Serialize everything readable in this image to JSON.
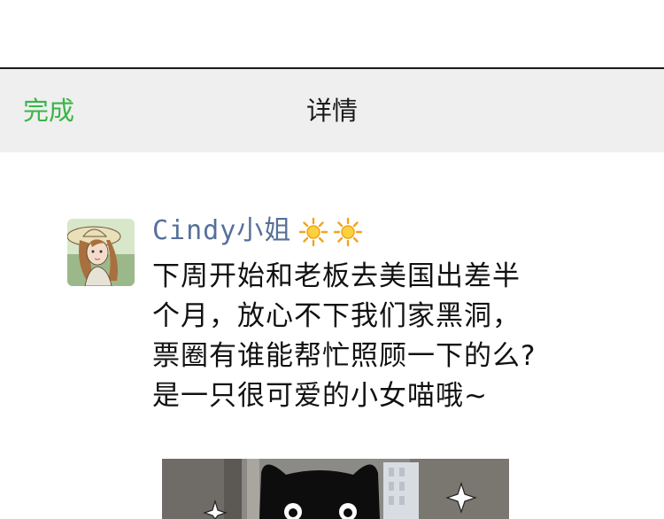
{
  "navbar": {
    "done_label": "完成",
    "title": "详情"
  },
  "post": {
    "username": "Cindy小姐",
    "emojis": [
      "sun-icon",
      "sun-icon"
    ],
    "lines": [
      "下周开始和老板去美国出差半",
      "个月，放心不下我们家黑洞，",
      "票圈有谁能帮忙照顾一下的么?",
      "是一只很可爱的小女喵哦~"
    ]
  },
  "colors": {
    "accent": "#3ab44a",
    "username": "#56709a",
    "navbar_bg": "#efefef"
  }
}
